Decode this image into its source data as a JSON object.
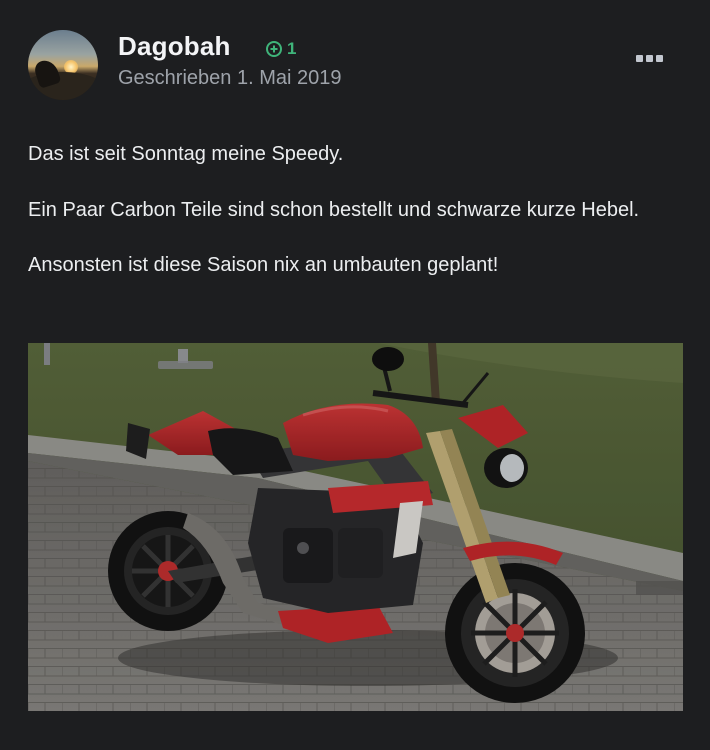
{
  "author": {
    "name": "Dagobah",
    "reputation": "1",
    "avatar_icon": "avatar-sunset-rider"
  },
  "post": {
    "date_label": "Geschrieben 1. Mai 2019",
    "paragraphs": [
      "Das ist seit Sonntag meine Speedy.",
      "Ein Paar Carbon Teile sind schon bestellt und schwarze kurze Hebel.",
      "Ansonsten ist diese Saison nix an umbauten geplant!"
    ],
    "image_alt_icon": "motorcycle-photo"
  },
  "colors": {
    "background": "#1d1e20",
    "reputation_green": "#3fb47a",
    "muted_text": "#9ea3aa"
  }
}
